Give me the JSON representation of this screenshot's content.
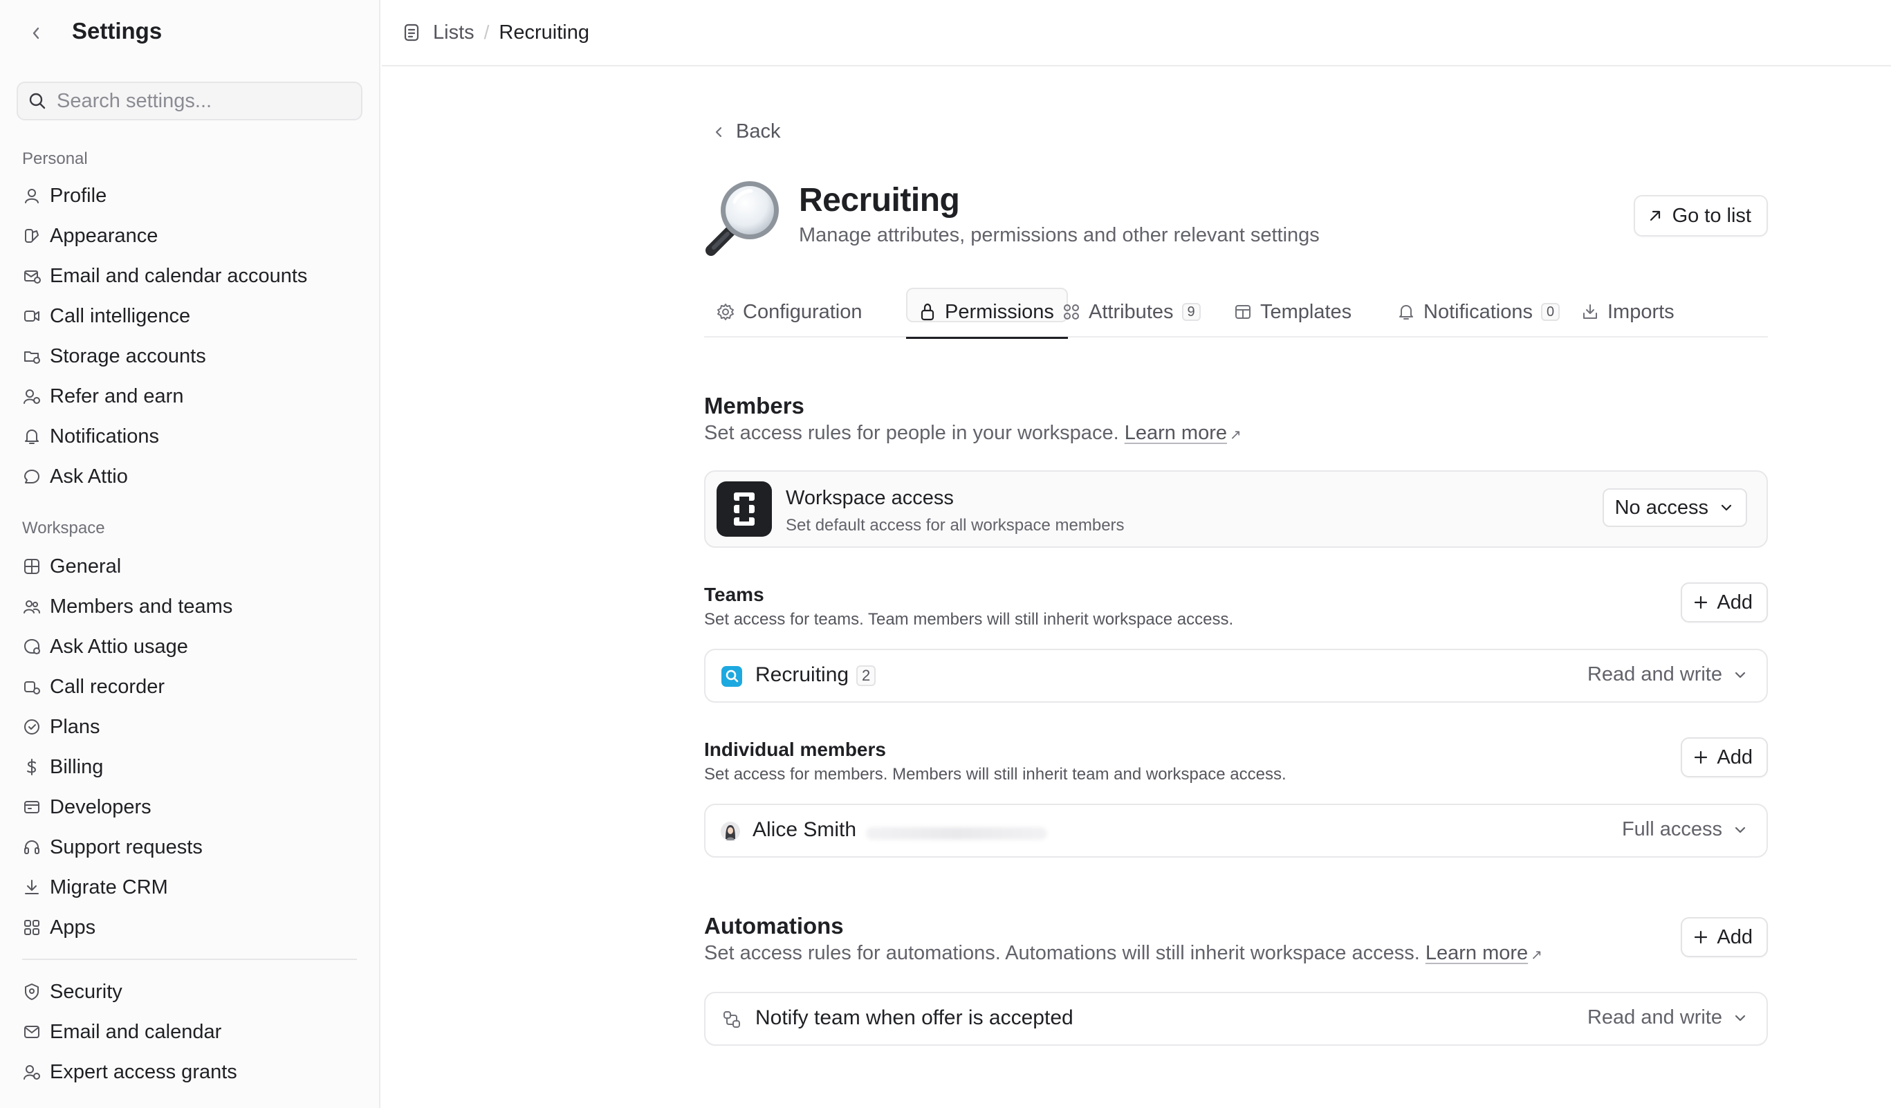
{
  "sidebar": {
    "title": "Settings",
    "search_placeholder": "Search settings...",
    "sections": {
      "personal": "Personal",
      "workspace": "Workspace"
    },
    "personal_items": [
      {
        "label": "Profile",
        "icon": "user-icon"
      },
      {
        "label": "Appearance",
        "icon": "palette-icon"
      },
      {
        "label": "Email and calendar accounts",
        "icon": "mail-calendar-icon"
      },
      {
        "label": "Call intelligence",
        "icon": "video-icon"
      },
      {
        "label": "Storage accounts",
        "icon": "folder-icon"
      },
      {
        "label": "Refer and earn",
        "icon": "user-plus-icon"
      },
      {
        "label": "Notifications",
        "icon": "bell-icon"
      },
      {
        "label": "Ask Attio",
        "icon": "chat-bubble-icon"
      }
    ],
    "workspace_items": [
      {
        "label": "General",
        "icon": "grid-icon"
      },
      {
        "label": "Members and teams",
        "icon": "users-icon"
      },
      {
        "label": "Ask Attio usage",
        "icon": "usage-icon"
      },
      {
        "label": "Call recorder",
        "icon": "recorder-icon"
      },
      {
        "label": "Plans",
        "icon": "plans-icon"
      },
      {
        "label": "Billing",
        "icon": "dollar-icon"
      },
      {
        "label": "Developers",
        "icon": "code-window-icon"
      },
      {
        "label": "Support requests",
        "icon": "headset-icon"
      },
      {
        "label": "Migrate CRM",
        "icon": "download-icon"
      },
      {
        "label": "Apps",
        "icon": "apps-icon"
      }
    ],
    "extra_items": [
      {
        "label": "Security",
        "icon": "shield-icon"
      },
      {
        "label": "Email and calendar",
        "icon": "envelope-icon"
      },
      {
        "label": "Expert access grants",
        "icon": "user-key-icon"
      }
    ]
  },
  "breadcrumb": {
    "parent": "Lists",
    "current": "Recruiting"
  },
  "page": {
    "back_label": "Back",
    "title": "Recruiting",
    "subtitle": "Manage attributes, permissions and other relevant settings",
    "go_to_list_label": "Go to list"
  },
  "tabs": [
    {
      "label": "Configuration",
      "icon": "gear-icon"
    },
    {
      "label": "Permissions",
      "icon": "lock-icon",
      "active": true
    },
    {
      "label": "Attributes",
      "icon": "attributes-icon",
      "badge": "9"
    },
    {
      "label": "Templates",
      "icon": "templates-icon"
    },
    {
      "label": "Notifications",
      "icon": "bell-icon",
      "badge": "0"
    },
    {
      "label": "Imports",
      "icon": "import-icon"
    }
  ],
  "members": {
    "title": "Members",
    "description": "Set access rules for people in your workspace.",
    "learn_more": "Learn more",
    "ext_arrow": "↗",
    "workspace_access": {
      "title": "Workspace access",
      "subtitle": "Set default access for all workspace members",
      "value": "No access"
    }
  },
  "teams": {
    "title": "Teams",
    "description": "Set access for teams. Team members will still inherit workspace access.",
    "add_label": "Add",
    "rows": [
      {
        "name": "Recruiting",
        "count": "2",
        "access": "Read and write"
      }
    ]
  },
  "individual": {
    "title": "Individual members",
    "description": "Set access for members. Members will still inherit team and workspace access.",
    "add_label": "Add",
    "rows": [
      {
        "name": "Alice Smith",
        "access": "Full access"
      }
    ]
  },
  "automations": {
    "title": "Automations",
    "description": "Set access rules for automations. Automations will still inherit workspace access.",
    "learn_more": "Learn more",
    "ext_arrow": "↗",
    "add_label": "Add",
    "rows": [
      {
        "name": "Notify team when offer is accepted",
        "access": "Read and write"
      }
    ]
  },
  "colors": {
    "text": "#1f2024",
    "muted": "#62636a",
    "border": "#e8e8eb",
    "team_icon": "#1da9e0"
  }
}
